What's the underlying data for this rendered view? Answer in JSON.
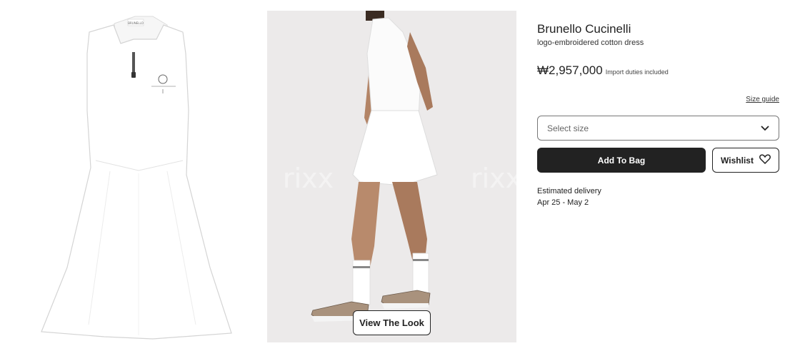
{
  "product": {
    "brand": "Brunello Cucinelli",
    "name": "logo-embroidered cotton dress",
    "price": "₩2,957,000",
    "duties_note": "Import duties included"
  },
  "gallery": {
    "view_the_look_label": "View The Look",
    "watermark": "rixx",
    "neck_logo": "BRUNELLO"
  },
  "size": {
    "guide_label": "Size guide",
    "placeholder": "Select size"
  },
  "actions": {
    "add_to_bag_label": "Add To Bag",
    "wishlist_label": "Wishlist"
  },
  "delivery": {
    "label": "Estimated delivery",
    "dates": "Apr 25 - May 2"
  },
  "icons": {
    "dropdown": "chevron-down-icon",
    "wishlist": "heart-icon"
  },
  "colors": {
    "primary_button": "#222222",
    "model_background": "#eceaea",
    "dress": "#ffffff",
    "sneaker": "#a9927d"
  }
}
